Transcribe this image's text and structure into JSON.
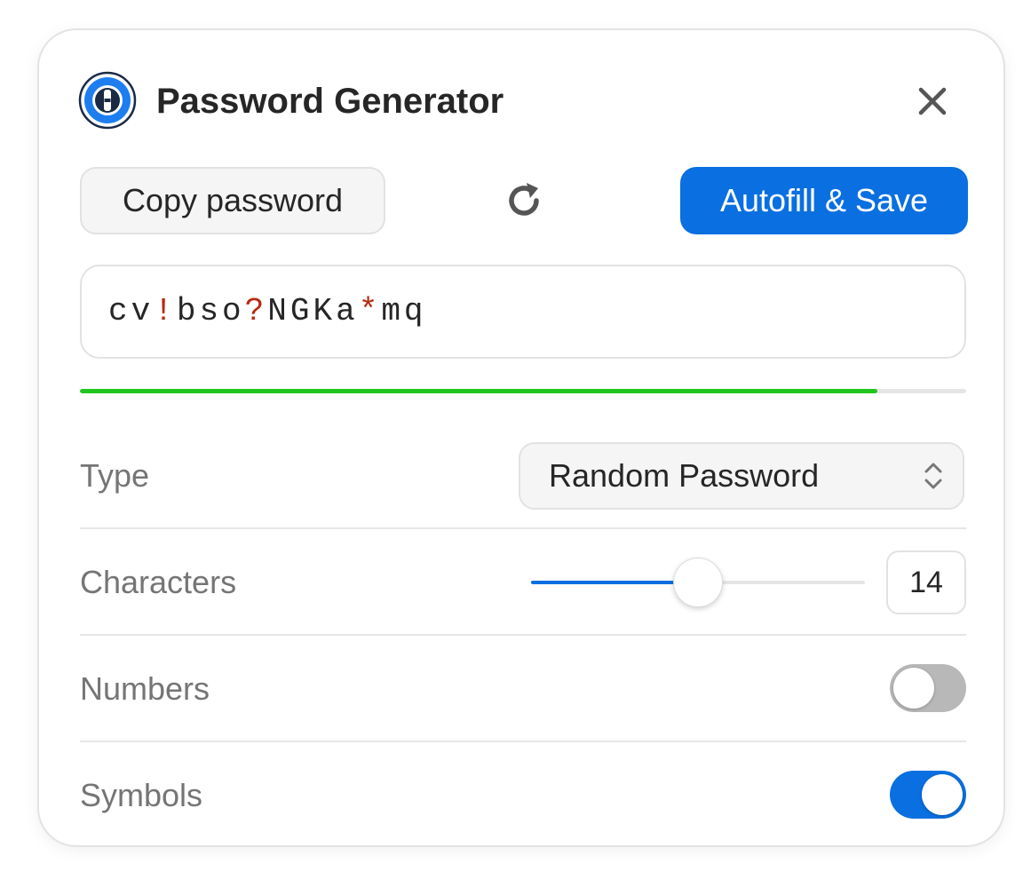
{
  "window": {
    "title": "Password Generator"
  },
  "icons": {
    "logo": "1password-logo",
    "close": "close-icon",
    "refresh": "refresh-icon",
    "select": "chevron-up-down-icon"
  },
  "actions": {
    "copy_label": "Copy password",
    "autofill_label": "Autofill & Save"
  },
  "password": {
    "chars": [
      {
        "c": "c",
        "symbol": false
      },
      {
        "c": "v",
        "symbol": false
      },
      {
        "c": "!",
        "symbol": true
      },
      {
        "c": "b",
        "symbol": false
      },
      {
        "c": "s",
        "symbol": false
      },
      {
        "c": "o",
        "symbol": false
      },
      {
        "c": "?",
        "symbol": true
      },
      {
        "c": "N",
        "symbol": false
      },
      {
        "c": "G",
        "symbol": false
      },
      {
        "c": "K",
        "symbol": false
      },
      {
        "c": "a",
        "symbol": false
      },
      {
        "c": "*",
        "symbol": true
      },
      {
        "c": "m",
        "symbol": false
      },
      {
        "c": "q",
        "symbol": false
      }
    ],
    "strength": 0.9
  },
  "settings": {
    "type": {
      "label": "Type",
      "value": "Random Password"
    },
    "characters": {
      "label": "Characters",
      "value": "14",
      "slider_fraction": 0.5
    },
    "numbers": {
      "label": "Numbers",
      "enabled": false
    },
    "symbols": {
      "label": "Symbols",
      "enabled": true
    }
  },
  "colors": {
    "accent": "#0a6fe0",
    "strength": "#21c51f",
    "symbol_text": "#b8290f",
    "toggle_off": "#b8b8b8"
  }
}
